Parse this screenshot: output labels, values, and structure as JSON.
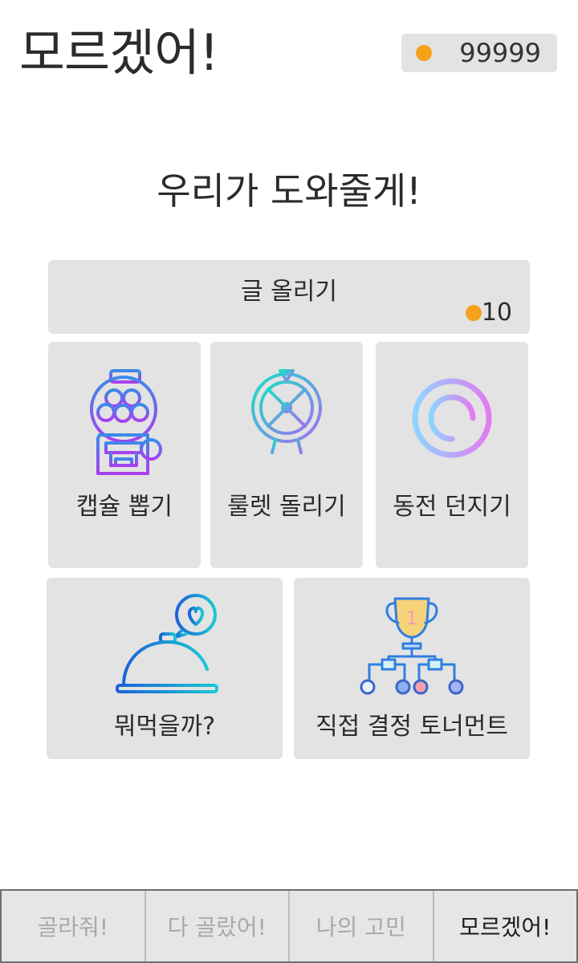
{
  "header": {
    "title": "모르겠어!",
    "coins": "99999",
    "coin_color": "#f5a21b"
  },
  "headline": "우리가 도와줄게!",
  "post_card": {
    "label": "글 올리기",
    "cost": "10"
  },
  "tools": [
    {
      "label": "캡슐 뽑기",
      "icon": "gumball-machine-icon"
    },
    {
      "label": "룰렛 돌리기",
      "icon": "roulette-wheel-icon"
    },
    {
      "label": "동전 던지기",
      "icon": "coin-ring-icon"
    },
    {
      "label": "뭐먹을까?",
      "icon": "food-cloche-icon"
    },
    {
      "label": "직접 결정 토너먼트",
      "icon": "trophy-bracket-icon"
    }
  ],
  "tabs": [
    {
      "label": "골라줘!",
      "active": false
    },
    {
      "label": "다 골랐어!",
      "active": false
    },
    {
      "label": "나의 고민",
      "active": false
    },
    {
      "label": "모르겠어!",
      "active": true
    }
  ]
}
